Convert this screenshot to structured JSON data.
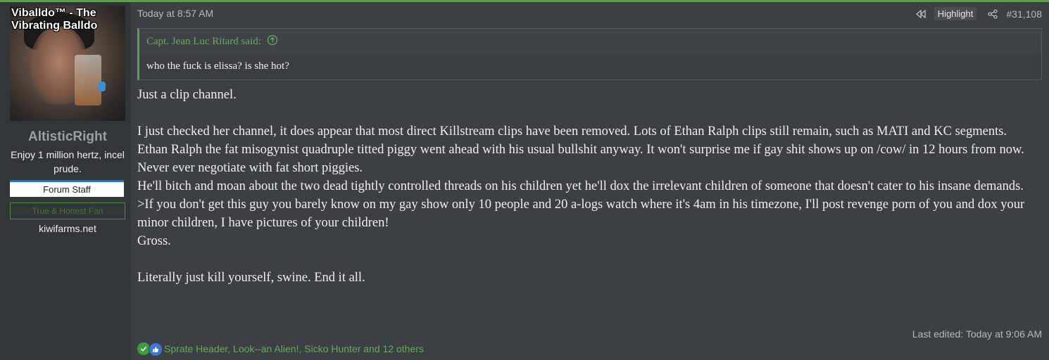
{
  "user": {
    "avatar_text": "Viballdo™ - The Vibrating Balldo",
    "name": "AltisticRight",
    "title": "Enjoy 1 million hertz, incel prude.",
    "banner_staff": "Forum Staff",
    "banner_fan": "True & Honest Fan",
    "site": "kiwifarms.net"
  },
  "post": {
    "timestamp": "Today at 8:57 AM",
    "highlight_label": "Highlight",
    "post_number": "#31,108",
    "quote": {
      "author": "Capt. Jean Luc Ritard said:",
      "text": "who the fuck is elissa? is she hot?"
    },
    "body": {
      "p1": "Just a clip channel.",
      "p2": "I just checked her channel, it does appear that most direct Killstream clips have been removed. Lots of Ethan Ralph clips still remain, such as MATI and KC segments.",
      "p3": "Ethan Ralph the fat misogynist quadruple titted piggy went ahead with his usual bullshit anyway. It won't surprise me if gay shit shows up on /cow/ in 12 hours from now. Never ever negotiate with fat short piggies.",
      "p4": "He'll bitch and moan about the two dead tightly controlled threads on his children yet he'll dox the irrelevant children of someone that doesn't cater to his insane demands.",
      "p5": ">If you don't get this guy you barely know on my gay show only 10 people and 20 a-logs watch where it's 4am in his timezone, I'll post revenge porn of you and dox your minor children, I have pictures of your children!",
      "p6": "Gross.",
      "p7": "Literally just kill yourself, swine. End it all."
    },
    "last_edited": "Last edited: Today at 9:06 AM",
    "reactions_text": "Sprate Header, Look--an Alien!, Sicko Hunter and 12 others"
  },
  "icons": {
    "rewind": "rewind-icon",
    "share": "share-icon",
    "quote_up": "arrow-up-circle-icon",
    "check": "check-icon",
    "like": "thumbs-up-icon"
  },
  "colors": {
    "accent_green": "#5f9e52",
    "link_green": "#6aa85c",
    "staff_blue": "#2a6fb0"
  }
}
